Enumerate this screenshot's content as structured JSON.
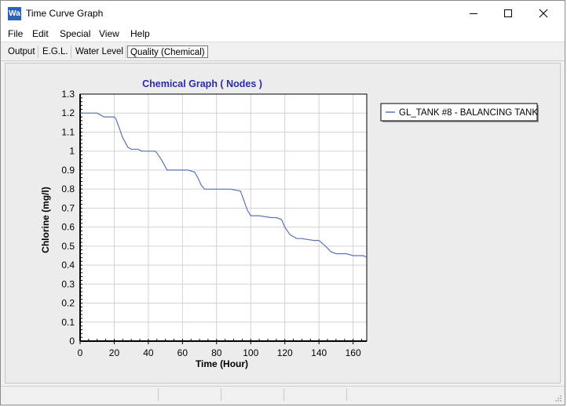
{
  "window": {
    "app_icon_text": "Wa",
    "title": "Time Curve Graph",
    "minimize_icon": "minimize-icon",
    "maximize_icon": "maximize-icon",
    "close_icon": "close-icon"
  },
  "menu": {
    "items": [
      "File",
      "Edit",
      "Special",
      "View",
      "Help"
    ]
  },
  "tabs": {
    "items": [
      "Output",
      "E.G.L.",
      "Water Level",
      "Quality (Chemical)"
    ],
    "active": "Quality (Chemical)"
  },
  "chart_data": {
    "type": "line",
    "title": "Chemical Graph ( Nodes )",
    "xlabel": "Time (Hour)",
    "ylabel": "Chlorine (mg/l)",
    "xlim": [
      0,
      168
    ],
    "ylim": [
      0,
      1.3
    ],
    "x_ticks": [
      0,
      20,
      40,
      60,
      80,
      100,
      120,
      140,
      160
    ],
    "y_ticks": [
      0,
      0.1,
      0.2,
      0.3,
      0.4,
      0.5,
      0.6,
      0.7,
      0.8,
      0.9,
      1,
      1.1,
      1.2,
      1.3
    ],
    "y_tick_labels": [
      "0",
      "0.1",
      "0.2",
      "0.3",
      "0.4",
      "0.5",
      "0.6",
      "0.7",
      "0.8",
      "0.9",
      "1",
      "1.1",
      "1.2",
      "1.3"
    ],
    "grid": true,
    "legend_position": "top-right",
    "series_color": "#5b73b5",
    "series": [
      {
        "name": "GL_TANK #8 - BALANCING TANK",
        "x": [
          0,
          10,
          12,
          14,
          20,
          21,
          23,
          25,
          28,
          30,
          34,
          36,
          38,
          44,
          45,
          48,
          51,
          57,
          63,
          67,
          69,
          71,
          73,
          76,
          80,
          88,
          94,
          96,
          98,
          100,
          105,
          112,
          115,
          118,
          120,
          123,
          127,
          130,
          137,
          140,
          145,
          147,
          150,
          156,
          160,
          166,
          168
        ],
        "values": [
          1.2,
          1.2,
          1.19,
          1.18,
          1.18,
          1.17,
          1.12,
          1.07,
          1.02,
          1.01,
          1.01,
          1.0,
          1.0,
          1.0,
          0.99,
          0.95,
          0.9,
          0.9,
          0.9,
          0.89,
          0.86,
          0.82,
          0.8,
          0.8,
          0.8,
          0.8,
          0.79,
          0.74,
          0.69,
          0.66,
          0.66,
          0.65,
          0.65,
          0.64,
          0.6,
          0.56,
          0.54,
          0.54,
          0.53,
          0.53,
          0.49,
          0.47,
          0.46,
          0.46,
          0.45,
          0.45,
          0.44
        ]
      }
    ]
  }
}
